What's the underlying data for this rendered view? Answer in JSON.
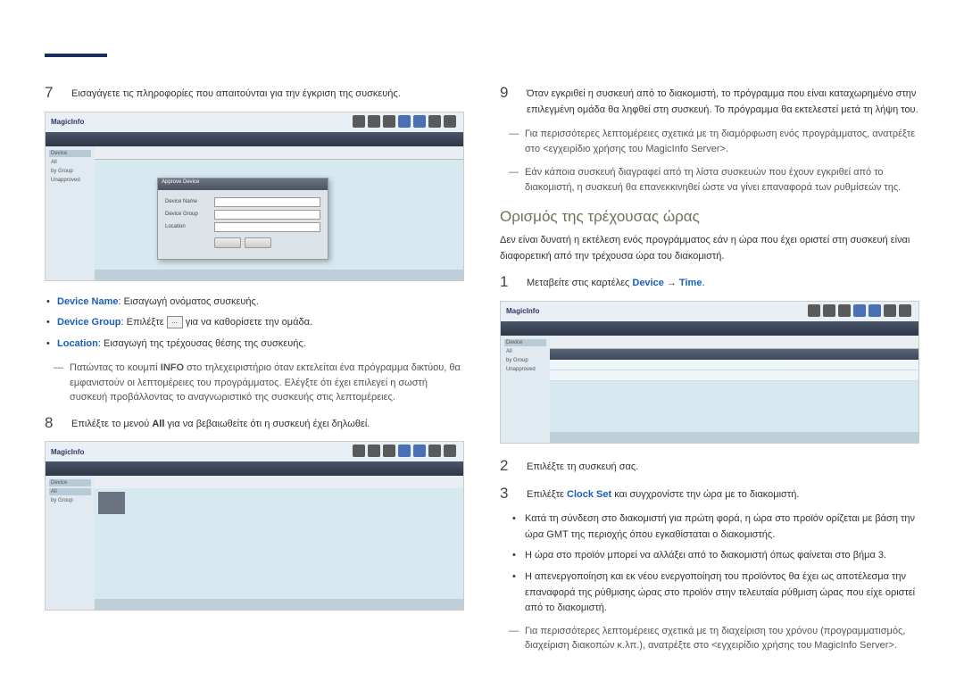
{
  "left": {
    "step7": {
      "num": "7",
      "text": "Εισαγάγετε τις πληροφορίες που απαιτούνται για την έγκριση της συσκευής."
    },
    "bullets": {
      "b1_label": "Device Name",
      "b1_text": ": Εισαγωγή ονόματος συσκευής.",
      "b2_label": "Device Group",
      "b2_pre": ": Επιλέξτε ",
      "b2_btn": "...",
      "b2_post": " για να καθορίσετε την ομάδα.",
      "b3_label": "Location",
      "b3_text": ": Εισαγωγή της τρέχουσας θέσης της συσκευής."
    },
    "note1_pre": "Πατώντας το κουμπί ",
    "note1_info": "INFO",
    "note1_post": " στο τηλεχειριστήριο όταν εκτελείται ένα πρόγραμμα δικτύου, θα εμφανιστούν οι λεπτομέρειες του προγράμματος. Ελέγξτε ότι έχει επιλεγεί η σωστή συσκευή προβάλλοντας το αναγνωριστικό της συσκευής στις λεπτομέρειες.",
    "step8": {
      "num": "8",
      "pre": "Επιλέξτε το μενού ",
      "all": "All",
      "post": " για να βεβαιωθείτε ότι η συσκευή έχει δηλωθεί."
    },
    "screenshot_logo": "MagicInfo",
    "dialog_title": "Approve Device",
    "dialog_rows": {
      "r1": "Device Name",
      "r2": "Device Group",
      "r3": "Location"
    }
  },
  "right": {
    "step9": {
      "num": "9",
      "text": "Όταν εγκριθεί η συσκευή από το διακομιστή, το πρόγραμμα που είναι καταχωρημένο στην επιλεγμένη ομάδα θα ληφθεί στη συσκευή. Το πρόγραμμα θα εκτελεστεί μετά τη λήψη του."
    },
    "note2": "Για περισσότερες λεπτομέρειες σχετικά με τη διαμόρφωση ενός προγράμματος, ανατρέξτε στο <εγχειρίδιο χρήσης του MagicInfo Server>.",
    "note3": "Εάν κάποια συσκευή διαγραφεί από τη λίστα συσκευών που έχουν εγκριθεί από το διακομιστή, η συσκευή θα επανεκκινηθεί ώστε να γίνει επαναφορά των ρυθμίσεών της.",
    "section_title": "Ορισμός της τρέχουσας ώρας",
    "intro": "Δεν είναι δυνατή η εκτέλεση ενός προγράμματος εάν η ώρα που έχει οριστεί στη συσκευή είναι διαφορετική από την τρέχουσα ώρα του διακομιστή.",
    "step1": {
      "num": "1",
      "pre": "Μεταβείτε στις καρτέλες ",
      "device": "Device",
      "arrow": " → ",
      "time": "Time",
      "post": "."
    },
    "step2": {
      "num": "2",
      "text": "Επιλέξτε τη συσκευή σας."
    },
    "step3": {
      "num": "3",
      "pre": "Επιλέξτε ",
      "clockset": "Clock Set",
      "post": " και συγχρονίστε την ώρα με το διακομιστή."
    },
    "sub_bullets": {
      "sb1": "Κατά τη σύνδεση στο διακομιστή για πρώτη φορά, η ώρα στο προϊόν ορίζεται με βάση την ώρα GMT της περιοχής όπου εγκαθίσταται ο διακομιστής.",
      "sb2": "Η ώρα στο προϊόν μπορεί να αλλάξει από το διακομιστή όπως φαίνεται στο βήμα 3.",
      "sb3": "Η απενεργοποίηση και εκ νέου ενεργοποίηση του προϊόντος θα έχει ως αποτέλεσμα την επαναφορά της ρύθμισης ώρας στο προϊόν στην τελευταία ρύθμιση ώρας που είχε οριστεί από το διακομιστή."
    },
    "note4": "Για περισσότερες λεπτομέρειες σχετικά με τη διαχείριση του χρόνου (προγραμματισμός, διαχείριση διακοπών κ.λπ.), ανατρέξτε στο <εγχειρίδιο χρήσης του MagicInfo Server>."
  }
}
